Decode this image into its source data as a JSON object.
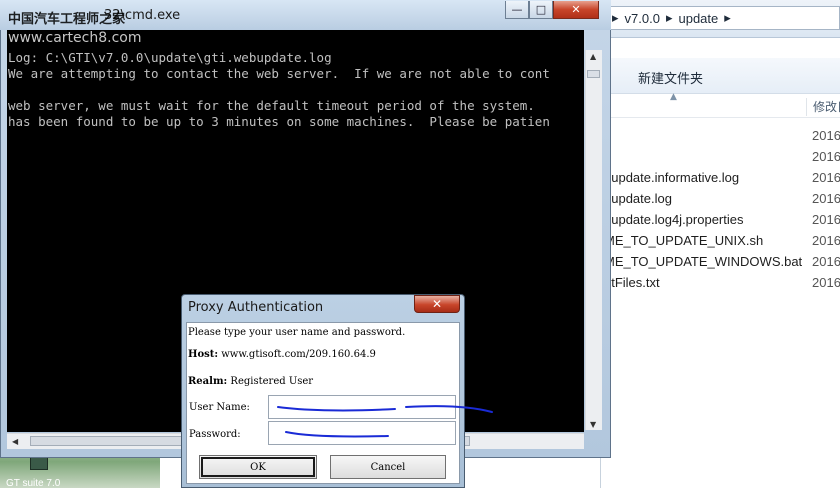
{
  "desktop": {
    "icon_label": "GT suite 7.0"
  },
  "explorer": {
    "breadcrumb": [
      "v7.0.0",
      "update"
    ],
    "toolbar": {
      "new_folder": "新建文件夹"
    },
    "column_modified": "修改日",
    "files": [
      {
        "name": "",
        "date": "2016"
      },
      {
        "name": "",
        "date": "2016"
      },
      {
        "name": "oupdate.informative.log",
        "date": "2016"
      },
      {
        "name": "oupdate.log",
        "date": "2016"
      },
      {
        "name": "oupdate.log4j.properties",
        "date": "2016"
      },
      {
        "name": "ME_TO_UPDATE_UNIX.sh",
        "date": "2016"
      },
      {
        "name": "ME_TO_UPDATE_WINDOWS.bat",
        "date": "2016"
      },
      {
        "name": "ntFiles.txt",
        "date": "2016"
      }
    ]
  },
  "cmd": {
    "title": "32\\cmd.exe",
    "title_overlay": "中国汽车工程师之家",
    "watermark": "www.cartech8.com",
    "controls": {
      "minimize": "—",
      "maximize": "□",
      "close": "✕"
    },
    "lines": [
      "Log: C:\\GTI\\v7.0.0\\update\\gti.webupdate.log",
      "We are attempting to contact the web server.  If we are not able to cont",
      "",
      "web server, we must wait for the default timeout period of the system.",
      "has been found to be up to 3 minutes on some machines.  Please be patien"
    ]
  },
  "dialog": {
    "title": "Proxy Authentication",
    "close_label": "✕",
    "prompt": "Please type your user name and password.",
    "host_label": "Host:",
    "host_value": "www.gtisoft.com/209.160.64.9",
    "realm_label": "Realm:",
    "realm_value": "Registered User",
    "username_label": "User Name:",
    "password_label": "Password:",
    "ok_label": "OK",
    "cancel_label": "Cancel"
  },
  "colors": {
    "console_bg": "#000000",
    "console_text": "#c0c0c0",
    "scribble": "#1a2bd6"
  }
}
